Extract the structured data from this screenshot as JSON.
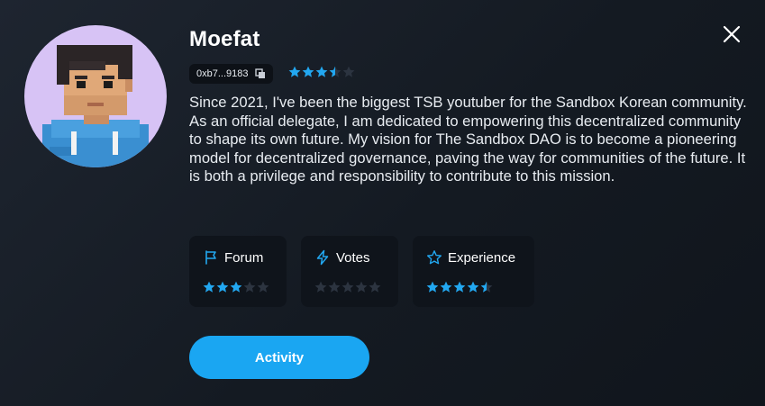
{
  "profile": {
    "name": "Moefat",
    "address": "0xb7...9183",
    "rating": 3.5,
    "bio": "Since 2021, I've been the biggest TSB youtuber for the Sandbox Korean community. As an official delegate, I am dedicated to empowering this decentralized community to shape its own future. My vision for The Sandbox DAO is to become a pioneering model for decentralized governance, paving the way for communities of the future. It is both a privilege and responsibility to contribute to this mission."
  },
  "stats": [
    {
      "label": "Forum",
      "icon": "flag-icon",
      "rating": 3
    },
    {
      "label": "Votes",
      "icon": "lightning-icon",
      "rating": 0
    },
    {
      "label": "Experience",
      "icon": "star-outline-icon",
      "rating": 4.5
    }
  ],
  "actions": {
    "activity_label": "Activity"
  },
  "colors": {
    "accent": "#1aa6f2",
    "star_filled": "#22a7f0",
    "star_empty": "#2c3440",
    "avatar_bg": "#d7c3f5"
  }
}
